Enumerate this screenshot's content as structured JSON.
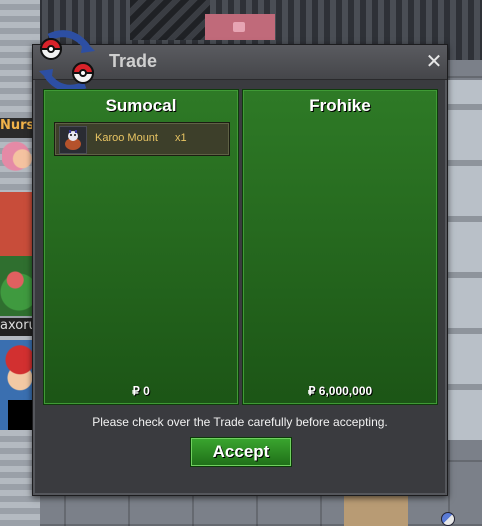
{
  "background": {
    "left_sign_text": "Nurse",
    "left_name_text": "axorul"
  },
  "trade_window": {
    "title": "Trade",
    "close_symbol": "✕",
    "left_player": {
      "name": "Sumocal",
      "items": [
        {
          "name": "Karoo Mount",
          "quantity": "x1",
          "icon": "mount-icon"
        }
      ],
      "money": "₽ 0"
    },
    "right_player": {
      "name": "Frohike",
      "items": [],
      "money": "₽ 6,000,000"
    },
    "notice": "Please check over the Trade carefully before accepting.",
    "accept_label": "Accept"
  },
  "colors": {
    "panel_green": "#2e7a26",
    "item_text": "#e7c463",
    "window_bg": "#3a3b3f"
  }
}
